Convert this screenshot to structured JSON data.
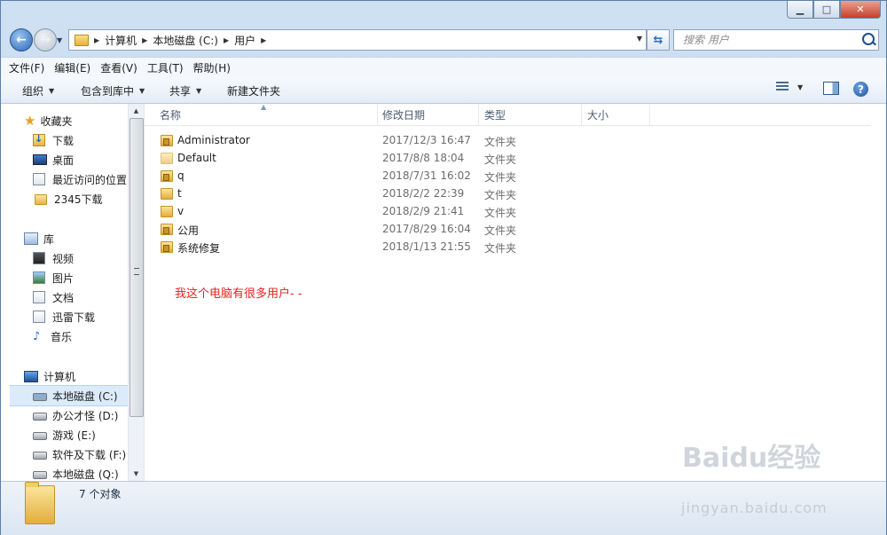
{
  "window": {
    "minimize": "▁",
    "maximize": "□",
    "close": "✕"
  },
  "address": {
    "crumbs": [
      "计算机",
      "本地磁盘 (C:)",
      "用户"
    ],
    "search_placeholder": "搜索 用户"
  },
  "menu": [
    "文件(F)",
    "编辑(E)",
    "查看(V)",
    "工具(T)",
    "帮助(H)"
  ],
  "toolbar": {
    "organize": "组织",
    "include_library": "包含到库中",
    "share": "共享",
    "new_folder": "新建文件夹",
    "help": "?"
  },
  "nav": {
    "favorites": "收藏夹",
    "favorites_items": [
      "下载",
      "桌面",
      "最近访问的位置",
      "2345下载"
    ],
    "libraries": "库",
    "library_items": [
      "视频",
      "图片",
      "文档",
      "迅雷下载",
      "音乐"
    ],
    "computer": "计算机",
    "drives": [
      "本地磁盘 (C:)",
      "办公才怪 (D:)",
      "游戏 (E:)",
      "软件及下载 (F:)",
      "本地磁盘 (Q:)"
    ]
  },
  "columns": {
    "name": "名称",
    "date": "修改日期",
    "type": "类型",
    "size": "大小"
  },
  "files": [
    {
      "name": "Administrator",
      "date": "2017/12/3 16:47",
      "type": "文件夹"
    },
    {
      "name": "Default",
      "date": "2017/8/8 18:04",
      "type": "文件夹"
    },
    {
      "name": "q",
      "date": "2018/7/31 16:02",
      "type": "文件夹"
    },
    {
      "name": "t",
      "date": "2018/2/2 22:39",
      "type": "文件夹"
    },
    {
      "name": "v",
      "date": "2018/2/9 21:41",
      "type": "文件夹"
    },
    {
      "name": "公用",
      "date": "2017/8/29 16:04",
      "type": "文件夹"
    },
    {
      "name": "系统修复",
      "date": "2018/1/13 21:55",
      "type": "文件夹"
    }
  ],
  "annotation": "我这个电脑有很多用户- -",
  "status": {
    "count": "7 个对象"
  },
  "watermark": {
    "main": "Baidu经验",
    "sub": "jingyan.baidu.com"
  }
}
